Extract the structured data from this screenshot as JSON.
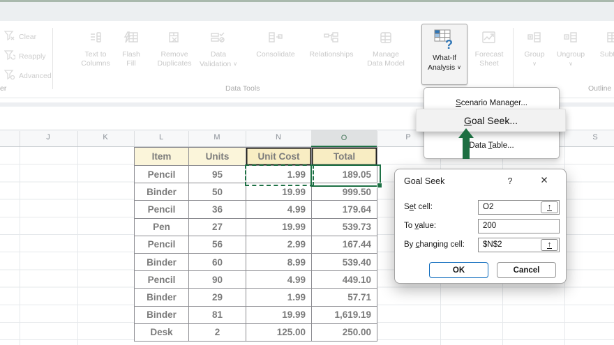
{
  "icons": {
    "chevron_down": "∨",
    "picker_up": "↑"
  },
  "ribbon": {
    "sort_filter_group": {
      "items": [
        "Clear",
        "Reapply",
        "Advanced"
      ],
      "group_label_truncated": "er"
    },
    "data_tools_group": {
      "label": "Data Tools",
      "text_to_columns": {
        "line1": "Text to",
        "line2": "Columns"
      },
      "flash_fill": {
        "line1": "Flash",
        "line2": "Fill"
      },
      "remove_duplicates": {
        "line1": "Remove",
        "line2": "Duplicates"
      },
      "data_validation": {
        "line1": "Data",
        "line2": "Validation"
      },
      "consolidate": "Consolidate",
      "relationships": "Relationships",
      "manage_data_model": {
        "line1": "Manage",
        "line2": "Data Model"
      }
    },
    "forecast_group": {
      "what_if_analysis": {
        "line1": "What-If",
        "line2": "Analysis"
      },
      "forecast_sheet": {
        "line1": "Forecast",
        "line2": "Sheet"
      }
    },
    "outline_group": {
      "group": "Group",
      "ungroup": "Ungroup",
      "subtotal": "Subtotal",
      "label": "Outline"
    }
  },
  "whatif_menu": {
    "items": [
      {
        "pre": "",
        "accel": "S",
        "post": "cenario Manager..."
      },
      {
        "pre": "",
        "accel": "G",
        "post": "oal Seek..."
      },
      {
        "pre": "Data ",
        "accel": "T",
        "post": "able..."
      }
    ],
    "arrow_color": "#1d6f42"
  },
  "goal_seek_dialog": {
    "title": "Goal Seek",
    "help_icon": "?",
    "close_icon": "✕",
    "fields": [
      {
        "pre": "S",
        "accel": "e",
        "post": "t cell:",
        "value": "O2",
        "picker": true
      },
      {
        "pre": "To ",
        "accel": "v",
        "post": "alue:",
        "value": "200",
        "picker": false
      },
      {
        "pre": "By ",
        "accel": "c",
        "post": "hanging cell:",
        "value": "$N$2",
        "picker": true
      }
    ],
    "ok_label": "OK",
    "cancel_label": "Cancel"
  },
  "sheet": {
    "visible_columns": [
      "J",
      "K",
      "L",
      "M",
      "N",
      "O",
      "P",
      "S"
    ],
    "selected_column": "O",
    "active_cell": "O2",
    "marching_ants_cell": "N2",
    "accent_green": "#1e7145"
  },
  "table": {
    "headers": [
      "Item",
      "Units",
      "Unit Cost",
      "Total"
    ],
    "rows": [
      [
        "Pencil",
        "95",
        "1.99",
        "189.05"
      ],
      [
        "Binder",
        "50",
        "19.99",
        "999.50"
      ],
      [
        "Pencil",
        "36",
        "4.99",
        "179.64"
      ],
      [
        "Pen",
        "27",
        "19.99",
        "539.73"
      ],
      [
        "Pencil",
        "56",
        "2.99",
        "167.44"
      ],
      [
        "Binder",
        "60",
        "8.99",
        "539.40"
      ],
      [
        "Pencil",
        "90",
        "4.99",
        "449.10"
      ],
      [
        "Binder",
        "29",
        "1.99",
        "57.71"
      ],
      [
        "Binder",
        "81",
        "19.99",
        "1,619.19"
      ],
      [
        "Desk",
        "2",
        "125.00",
        "250.00"
      ]
    ]
  }
}
